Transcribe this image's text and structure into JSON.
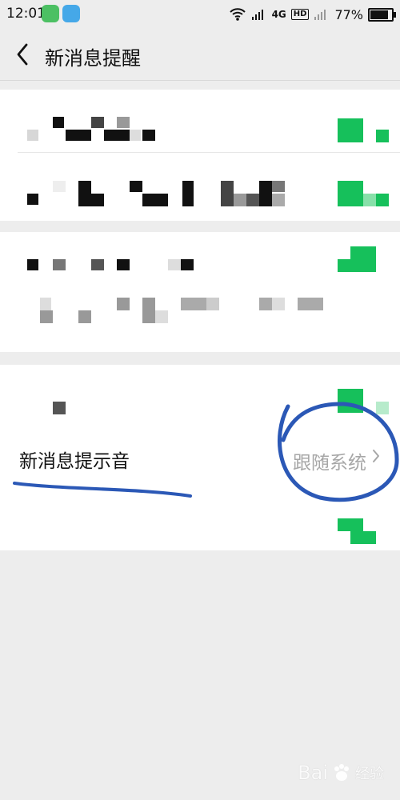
{
  "status_bar": {
    "time": "12:01",
    "network": "4G",
    "hd": "HD",
    "battery": "77%",
    "battery_level": 0.77
  },
  "nav": {
    "title": "新消息提醒"
  },
  "sound_setting": {
    "label": "新消息提示音",
    "value": "跟随系统"
  },
  "watermark": {
    "text": "Bai",
    "subtext": "经验"
  },
  "colors": {
    "background": "#ededed",
    "card": "#ffffff",
    "switch_green": "#16c05b",
    "annotation_blue": "#2b58b6"
  },
  "icons": {
    "back": "chevron-left-icon",
    "chevron": "chevron-right-icon",
    "wifi": "wifi-icon",
    "signal": "signal-icon",
    "battery": "battery-icon"
  }
}
